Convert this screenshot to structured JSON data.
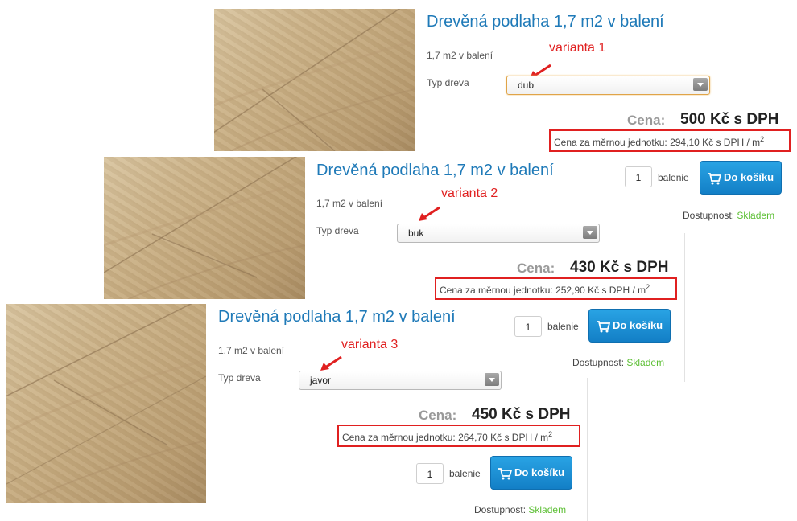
{
  "product": {
    "title": "Drevěná podlaha 1,7 m2 v balení",
    "subtitle": "1,7 m2 v balení",
    "wood_label": "Typ dreva",
    "price_label": "Cena:",
    "qty_unit": "balenie",
    "cart_button": "Do košíku",
    "cart_icon": "cart-icon",
    "availability_label": "Dostupnost:",
    "availability_value": "Skladem"
  },
  "variants": [
    {
      "annotation": "varianta 1",
      "wood_type": "dub",
      "price": "500 Kč s DPH",
      "unit_price": "Cena za měrnou jednotku: 294,10 Kč s DPH / m",
      "qty": "1"
    },
    {
      "annotation": "varianta 2",
      "wood_type": "buk",
      "price": "430 Kč s DPH",
      "unit_price": "Cena za měrnou jednotku: 252,90 Kč s DPH / m",
      "qty": "1"
    },
    {
      "annotation": "varianta 3",
      "wood_type": "javor",
      "price": "450 Kč s DPH",
      "unit_price": "Cena za měrnou jednotku: 264,70 Kč s DPH / m",
      "qty": "1"
    }
  ],
  "unit_exponent": "2",
  "colors": {
    "title": "#1f7ab8",
    "annotation": "#e02020",
    "button": "#1a8fd6",
    "available": "#5cbf34"
  }
}
